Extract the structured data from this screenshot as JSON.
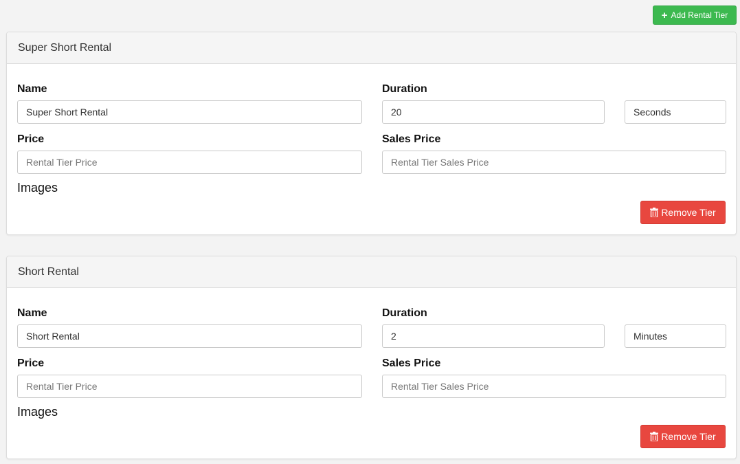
{
  "toolbar": {
    "add_label": "Add Rental Tier",
    "add_icon": "plus-icon"
  },
  "tiers": [
    {
      "header": "Super Short Rental",
      "name_label": "Name",
      "name_value": "Super Short Rental",
      "duration_label": "Duration",
      "duration_value": "20",
      "duration_unit": "Seconds",
      "price_label": "Price",
      "price_placeholder": "Rental Tier Price",
      "sales_price_label": "Sales Price",
      "sales_price_placeholder": "Rental Tier Sales Price",
      "images_label": "Images",
      "remove_label": "Remove Tier"
    },
    {
      "header": "Short Rental",
      "name_label": "Name",
      "name_value": "Short Rental",
      "duration_label": "Duration",
      "duration_value": "2",
      "duration_unit": "Minutes",
      "price_label": "Price",
      "price_placeholder": "Rental Tier Price",
      "sales_price_label": "Sales Price",
      "sales_price_placeholder": "Rental Tier Sales Price",
      "images_label": "Images",
      "remove_label": "Remove Tier"
    }
  ],
  "colors": {
    "add_button": "#3cb94f",
    "remove_button": "#e8473f",
    "page_background": "#f3f3f3",
    "panel_header": "#f5f5f5"
  }
}
